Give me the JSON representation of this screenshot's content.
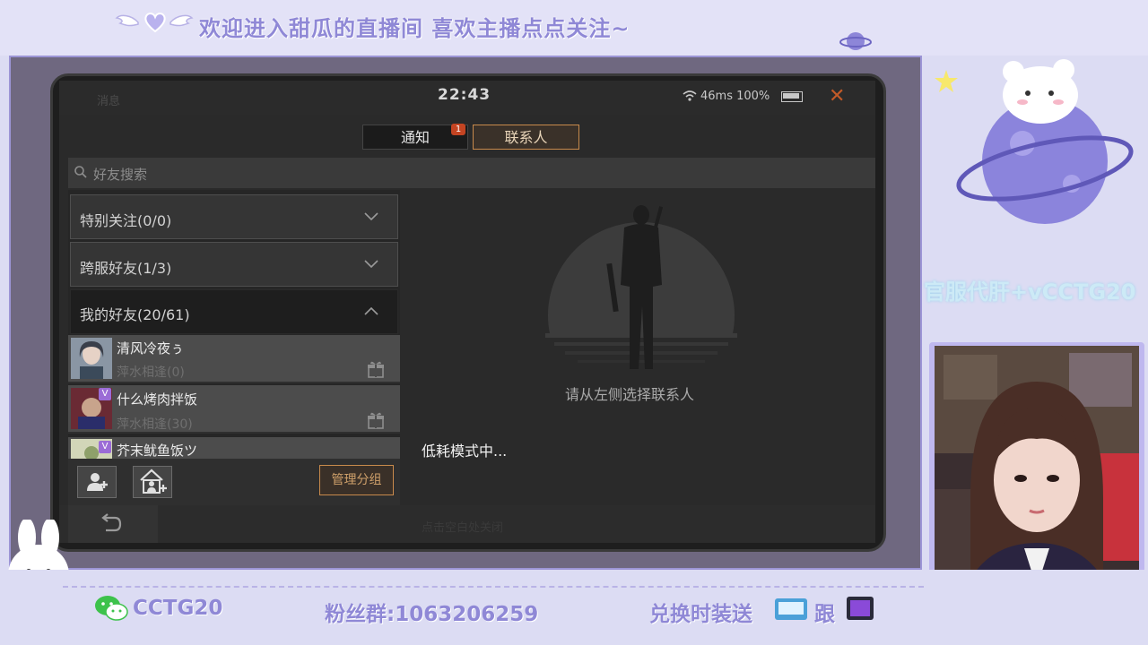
{
  "banner": {
    "text": "欢迎进入甜瓜的直播间 喜欢主播点点关注~"
  },
  "status_bar": {
    "label": "消息",
    "time": "22:43",
    "network": "46ms 100%",
    "close_icon": "close-x-icon"
  },
  "tabs": [
    {
      "label": "通知",
      "badge": "1",
      "active": false
    },
    {
      "label": "联系人",
      "active": true
    }
  ],
  "search": {
    "placeholder": "好友搜索"
  },
  "groups": [
    {
      "label": "特别关注(0/0)",
      "expanded": false
    },
    {
      "label": "跨服好友(1/3)",
      "expanded": false
    },
    {
      "label": "我的好友(20/61)",
      "expanded": true
    }
  ],
  "contacts": [
    {
      "name": "清风冷夜ぅ",
      "sub": "萍水相逢(0)",
      "gift_icon": "gift-icon"
    },
    {
      "name": "什么烤肉拌饭",
      "sub": "萍水相逢(30)",
      "gift_icon": "gift-icon",
      "vip": "V"
    },
    {
      "name": "芥末鱿鱼饭ツ",
      "vip": "V"
    }
  ],
  "buttons": {
    "manage": "管理分组",
    "back_icon": "back-arrow-icon",
    "add_friend_icon": "add-friend-icon",
    "add_group_icon": "add-group-icon"
  },
  "right_panel": {
    "empty_hint": "请从左侧选择联系人",
    "low_power": "低耗模式中..."
  },
  "footer_hint": "点击空白处关闭",
  "overlay": {
    "side_watermark": "官服代肝+vCCTG20",
    "wechat_id": "CCTG20",
    "fan_group": "粉丝群:1063206259",
    "exchange": "兑换时装送",
    "follow": "跟"
  },
  "colors": {
    "accent": "#c88a4c",
    "banner_text": "#8f88d6",
    "close": "#c25a28"
  }
}
